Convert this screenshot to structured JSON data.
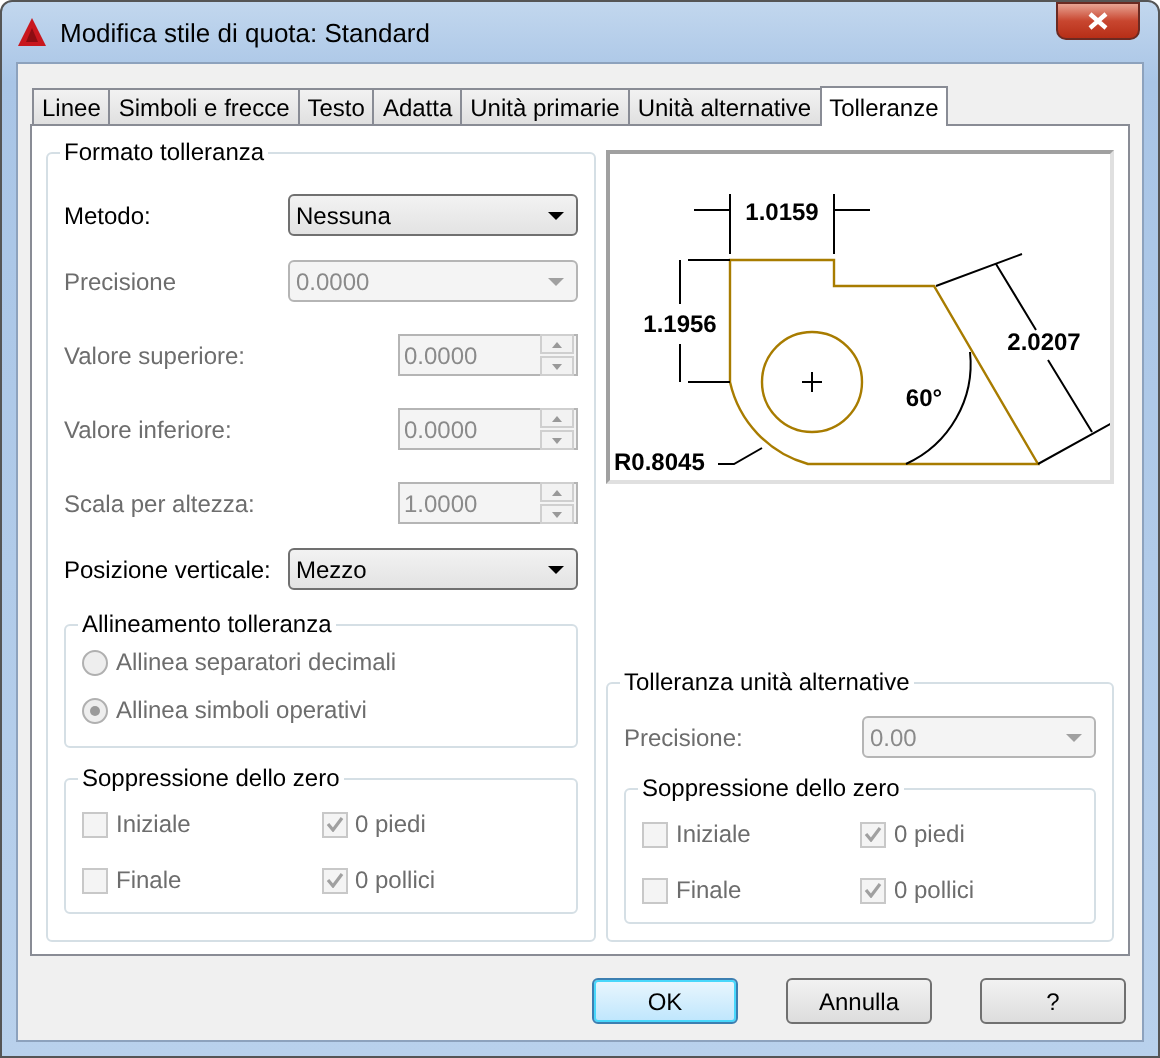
{
  "window": {
    "title": "Modifica stile di quota: Standard"
  },
  "tabs": [
    {
      "label": "Linee",
      "selected": false
    },
    {
      "label": "Simboli e frecce",
      "selected": false
    },
    {
      "label": "Testo",
      "selected": false
    },
    {
      "label": "Adatta",
      "selected": false
    },
    {
      "label": "Unità primarie",
      "selected": false
    },
    {
      "label": "Unità alternative",
      "selected": false
    },
    {
      "label": "Tolleranze",
      "selected": true
    }
  ],
  "tolerance_format": {
    "title": "Formato tolleranza",
    "fields": [
      {
        "kind": "dropdown",
        "label": "Metodo:",
        "value": "Nessuna",
        "disabled": false
      },
      {
        "kind": "dropdown",
        "label": "Precisione",
        "value": "0.0000",
        "disabled": true
      },
      {
        "kind": "spinner",
        "label": "Valore superiore:",
        "value": "0.0000",
        "disabled": true
      },
      {
        "kind": "spinner",
        "label": "Valore inferiore:",
        "value": "0.0000",
        "disabled": true
      },
      {
        "kind": "spinner",
        "label": "Scala per altezza:",
        "value": "1.0000",
        "disabled": true
      },
      {
        "kind": "dropdown",
        "label": "Posizione verticale:",
        "value": "Mezzo",
        "disabled": false
      }
    ],
    "alignment": {
      "title": "Allineamento tolleranza",
      "options": [
        {
          "label": "Allinea separatori decimali",
          "selected": false,
          "disabled": true
        },
        {
          "label": "Allinea simboli operativi",
          "selected": true,
          "disabled": true
        }
      ]
    },
    "zero_suppression": {
      "title": "Soppressione dello zero",
      "options": [
        {
          "label": "Iniziale",
          "checked": false,
          "disabled": true
        },
        {
          "label": "0 piedi",
          "checked": true,
          "disabled": true
        },
        {
          "label": "Finale",
          "checked": false,
          "disabled": true
        },
        {
          "label": "0 pollici",
          "checked": true,
          "disabled": true
        }
      ]
    }
  },
  "preview": {
    "labels": [
      "1.0159",
      "1.1956",
      "2.0207",
      "60°",
      "R0.8045"
    ]
  },
  "alt_tolerance": {
    "title": "Tolleranza unità alternative",
    "precision": {
      "label": "Precisione:",
      "value": "0.00",
      "disabled": true
    },
    "zero_suppression": {
      "title": "Soppressione dello zero",
      "options": [
        {
          "label": "Iniziale",
          "checked": false,
          "disabled": true
        },
        {
          "label": "0 piedi",
          "checked": true,
          "disabled": true
        },
        {
          "label": "Finale",
          "checked": false,
          "disabled": true
        },
        {
          "label": "0 pollici",
          "checked": true,
          "disabled": true
        }
      ]
    }
  },
  "buttons": [
    {
      "label": "OK",
      "default": true
    },
    {
      "label": "Annulla",
      "default": false
    },
    {
      "label": "?",
      "default": false
    }
  ]
}
